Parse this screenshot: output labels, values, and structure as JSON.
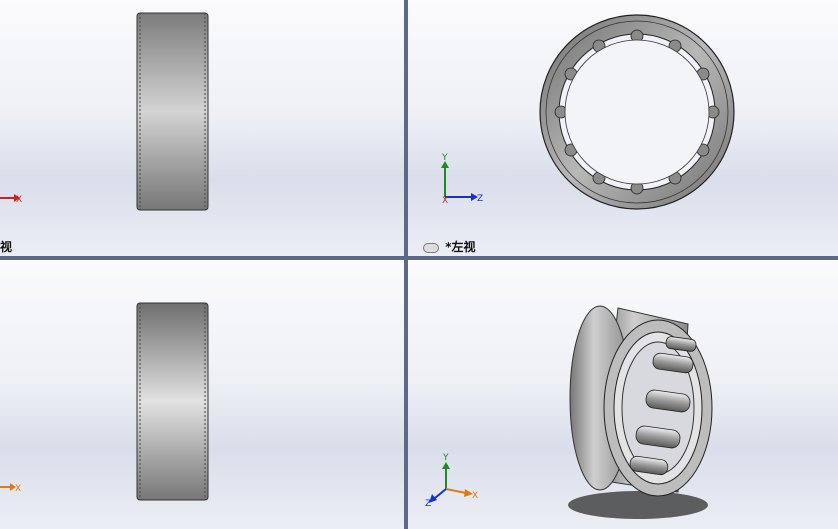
{
  "viewports": {
    "top_left": {
      "label": "视"
    },
    "top_right": {
      "label": "*左视"
    },
    "bottom_left": {
      "label": ""
    },
    "bottom_right": {
      "label": ""
    }
  },
  "axes": {
    "x": "X",
    "y": "Y",
    "z": "Z"
  },
  "colors": {
    "viewport_divider": "#5b6a86",
    "x_axis": "#d02020",
    "y_axis": "#1f8a1f",
    "z_axis": "#1a2fd0",
    "x_axis_orange": "#e07a10",
    "bearing_metal": "#9a9a9a"
  },
  "icons": {
    "view_link": "link-chain-icon",
    "triad": "coordinate-triad-icon"
  }
}
